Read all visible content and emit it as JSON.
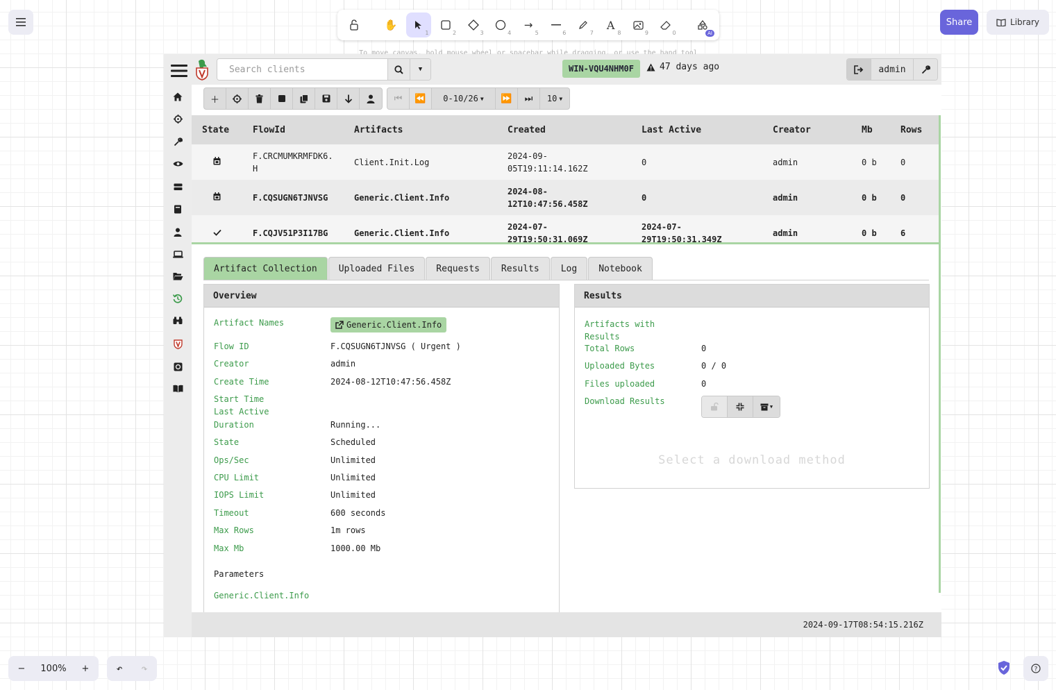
{
  "excalidraw": {
    "tools": [
      {
        "name": "lock",
        "num": ""
      },
      {
        "name": "hand",
        "num": ""
      },
      {
        "name": "selection",
        "num": "1"
      },
      {
        "name": "rectangle",
        "num": "2"
      },
      {
        "name": "diamond",
        "num": "3"
      },
      {
        "name": "ellipse",
        "num": "4"
      },
      {
        "name": "arrow",
        "num": "5"
      },
      {
        "name": "line",
        "num": "6"
      },
      {
        "name": "draw",
        "num": "7"
      },
      {
        "name": "text",
        "num": "8"
      },
      {
        "name": "image",
        "num": "9"
      },
      {
        "name": "eraser",
        "num": "0"
      },
      {
        "name": "more-tools",
        "num": ""
      }
    ],
    "ai_badge": "AI",
    "hint": "To move canvas, hold mouse wheel or spacebar while dragging, or use the hand tool",
    "share_label": "Share",
    "library_label": "Library",
    "zoom_level": "100%",
    "accent": "#6965db"
  },
  "app": {
    "search_placeholder": "Search clients",
    "client_id": "WIN-VQU4NHM0F",
    "last_seen": "47 days ago",
    "username": "admin",
    "pagination": {
      "range": "0-10/26",
      "page_size": "10"
    },
    "table": {
      "headers": [
        "State",
        "FlowId",
        "Artifacts",
        "Created",
        "Last Active",
        "Creator",
        "Mb",
        "Rows"
      ],
      "rows": [
        {
          "state_icon": "calendar-icon",
          "flow_id": "F.CRCMUMKRMFDK6.\nH",
          "artifact": "Client.Init.Log",
          "created": "2024-09-\n05T19:11:14.162Z",
          "last_active": "0",
          "creator": "admin",
          "mb": "0 b",
          "rows": "0"
        },
        {
          "state_icon": "calendar-icon",
          "flow_id": "F.CQSUGN6TJNVSG",
          "artifact": "Generic.Client.Info",
          "created": "2024-08-\n12T10:47:56.458Z",
          "last_active": "0",
          "creator": "admin",
          "mb": "0 b",
          "rows": "0"
        },
        {
          "state_icon": "check-icon",
          "flow_id": "F.CQJV51P3I17BG",
          "artifact": "Generic.Client.Info",
          "created": "2024-07-\n29T19:50:31.069Z",
          "last_active": "2024-07-\n29T19:50:31.349Z",
          "creator": "admin",
          "mb": "0 b",
          "rows": "6"
        }
      ]
    },
    "tabs": [
      "Artifact Collection",
      "Uploaded Files",
      "Requests",
      "Results",
      "Log",
      "Notebook"
    ],
    "overview": {
      "title": "Overview",
      "artifact_names_label": "Artifact Names",
      "artifact_name": "Generic.Client.Info",
      "fields": [
        {
          "key": "Flow ID",
          "value": "F.CQSUGN6TJNVSG ( Urgent )"
        },
        {
          "key": "Creator",
          "value": "admin"
        },
        {
          "key": "Create Time",
          "value": "2024-08-12T10:47:56.458Z"
        },
        {
          "key": "Start Time",
          "value": ""
        },
        {
          "key": "Last Active",
          "value": ""
        },
        {
          "key": "Duration",
          "value": "Running..."
        },
        {
          "key": "State",
          "value": "Scheduled"
        },
        {
          "key": "Ops/Sec",
          "value": "Unlimited"
        },
        {
          "key": "CPU Limit",
          "value": "Unlimited"
        },
        {
          "key": "IOPS Limit",
          "value": "Unlimited"
        },
        {
          "key": "Timeout",
          "value": "600 seconds"
        },
        {
          "key": "Max Rows",
          "value": "1m rows"
        },
        {
          "key": "Max Mb",
          "value": "1000.00 Mb"
        }
      ],
      "parameters_label": "Parameters",
      "parameters_artifact": "Generic.Client.Info"
    },
    "results": {
      "title": "Results",
      "artifacts_with_results_label": "Artifacts with\nResults",
      "fields": [
        {
          "key": "Total Rows",
          "value": "0"
        },
        {
          "key": "Uploaded Bytes",
          "value": "0 / 0"
        },
        {
          "key": "Files uploaded",
          "value": "0"
        }
      ],
      "download_label": "Download Results",
      "select_message": "Select a download method"
    },
    "footer_time": "2024-09-17T08:54:15.216Z",
    "colors": {
      "accent_green": "#a9d5a3",
      "label_green": "#3c9b4b"
    }
  }
}
